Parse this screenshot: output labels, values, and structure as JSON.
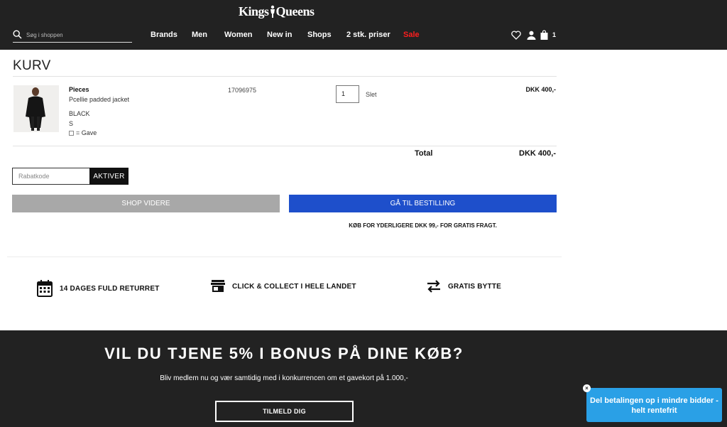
{
  "header": {
    "logo_text": "Kings Queens",
    "search_placeholder": "Søg i shoppen",
    "nav": [
      {
        "label": "Brands"
      },
      {
        "label": "Men"
      },
      {
        "label": "Women"
      },
      {
        "label": "New in"
      },
      {
        "label": "Shops"
      },
      {
        "label": "2 stk. priser"
      },
      {
        "label": "Sale"
      }
    ],
    "cart_count": "1",
    "icons": [
      "heart-icon",
      "user-icon",
      "bag-icon",
      "search-icon"
    ]
  },
  "cart": {
    "title": "KURV",
    "items": [
      {
        "brand": "Pieces",
        "name": "Pcellie padded jacket",
        "color": "BLACK",
        "size": "S",
        "gift_label": "= Gave",
        "sku": "17096975",
        "quantity": "1",
        "delete_label": "Slet",
        "price": "DKK 400,-"
      }
    ],
    "total_label": "Total",
    "total_value": "DKK 400,-",
    "coupon_placeholder": "Rabatkode",
    "activate_label": "AKTIVER",
    "continue_label": "SHOP VIDERE",
    "checkout_label": "GÅ TIL BESTILLING",
    "free_shipping_note": "KØB FOR YDERLIGERE DKK 99,- FOR GRATIS FRAGT."
  },
  "usps": [
    {
      "icon": "calendar-icon",
      "label": "14 DAGES FULD RETURRET"
    },
    {
      "icon": "store-icon",
      "label": "CLICK & COLLECT I HELE LANDET"
    },
    {
      "icon": "swap-arrows-icon",
      "label": "GRATIS BYTTE"
    }
  ],
  "footer": {
    "headline": "VIL DU TJENE 5% I BONUS PÅ DINE KØB?",
    "subline": "Bliv medlem nu og vær samtidig med i konkurrencen om et gavekort på 1.000,-",
    "signup_label": "TILMELD DIG"
  },
  "payment_popup": {
    "text": "Del betalingen op i mindre bidder - helt rentefrit",
    "close": "×"
  },
  "colors": {
    "header_bg": "#222222",
    "sale": "#ff1e1e",
    "checkout_button": "#1e4fcb",
    "continue_button": "#a8a8a8",
    "popup": "#2aa0e6"
  }
}
